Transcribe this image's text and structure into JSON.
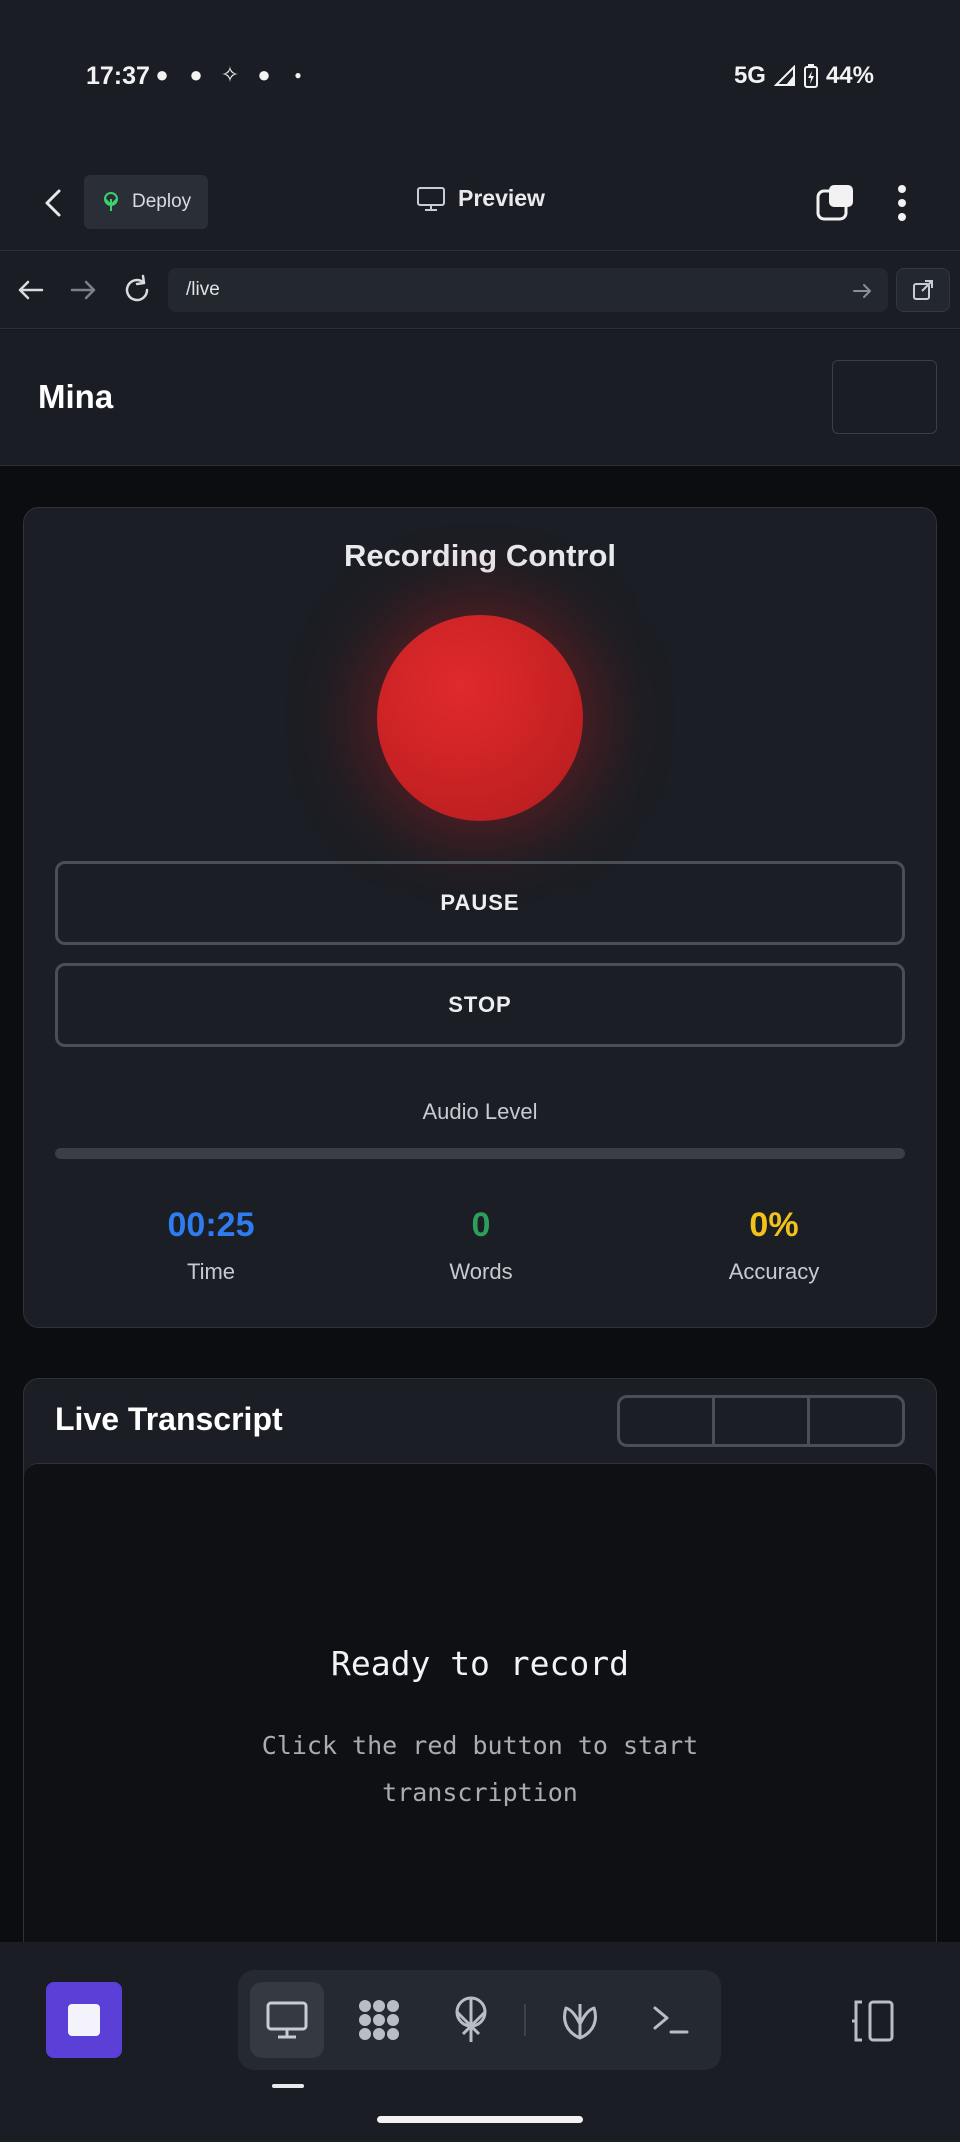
{
  "status_bar": {
    "time": "17:37",
    "network": "5G",
    "battery": "44%",
    "notification_icons": [
      "snapchat-icon",
      "snapchat-icon",
      "slack-icon",
      "snapchat-icon",
      "dot-icon"
    ]
  },
  "app_header": {
    "deploy_label": "Deploy",
    "title": "Preview"
  },
  "url_bar": {
    "value": "/live"
  },
  "page_header": {
    "brand": "Mina"
  },
  "recording_card": {
    "title": "Recording Control",
    "pause_label": "PAUSE",
    "stop_label": "STOP",
    "audio_label": "Audio Level",
    "audio_level": 0,
    "stats": [
      {
        "value": "00:25",
        "label": "Time",
        "color": "#2f7cf0"
      },
      {
        "value": "0",
        "label": "Words",
        "color": "#2e9e5b"
      },
      {
        "value": "0%",
        "label": "Accuracy",
        "color": "#f2c21b"
      }
    ]
  },
  "transcript_card": {
    "title": "Live Transcript",
    "empty_title": "Ready to record",
    "empty_hint": "Click the red button to start transcription"
  },
  "dock": {
    "tools": [
      "monitor-icon",
      "agents-icon",
      "deploy-icon",
      "shell-icon",
      "terminal-icon"
    ],
    "accent": "#5b3fd6"
  }
}
